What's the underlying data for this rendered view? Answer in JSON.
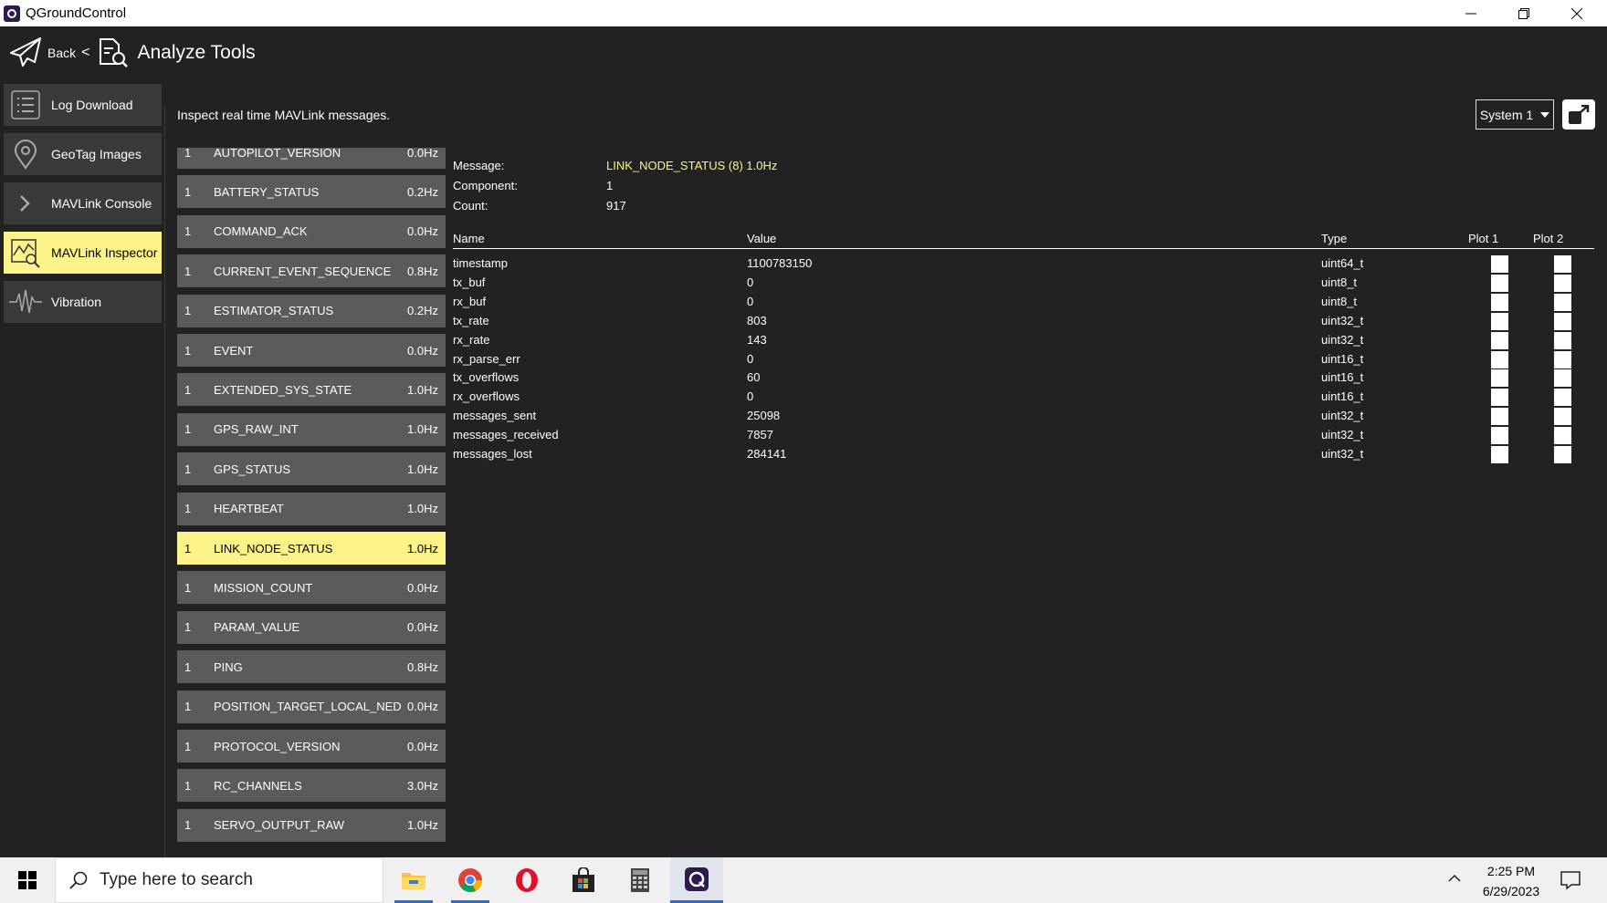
{
  "window": {
    "title": "QGroundControl"
  },
  "header": {
    "back_label": "Back",
    "separator": "<",
    "page_title": "Analyze Tools"
  },
  "sidebar": {
    "items": [
      {
        "label": "Log Download",
        "icon": "list-icon"
      },
      {
        "label": "GeoTag Images",
        "icon": "map-pin-icon"
      },
      {
        "label": "MAVLink Console",
        "icon": "chevron-right-icon"
      },
      {
        "label": "MAVLink Inspector",
        "icon": "chart-magnifier-icon",
        "active": true
      },
      {
        "label": "Vibration",
        "icon": "waveform-icon"
      }
    ]
  },
  "inspector": {
    "description": "Inspect real time MAVLink messages.",
    "system_selector": "System 1",
    "messages": [
      {
        "comp": "1",
        "name": "AUTOPILOT_VERSION",
        "rate": "0.0Hz"
      },
      {
        "comp": "1",
        "name": "BATTERY_STATUS",
        "rate": "0.2Hz"
      },
      {
        "comp": "1",
        "name": "COMMAND_ACK",
        "rate": "0.0Hz"
      },
      {
        "comp": "1",
        "name": "CURRENT_EVENT_SEQUENCE",
        "rate": "0.8Hz"
      },
      {
        "comp": "1",
        "name": "ESTIMATOR_STATUS",
        "rate": "0.2Hz"
      },
      {
        "comp": "1",
        "name": "EVENT",
        "rate": "0.0Hz"
      },
      {
        "comp": "1",
        "name": "EXTENDED_SYS_STATE",
        "rate": "1.0Hz"
      },
      {
        "comp": "1",
        "name": "GPS_RAW_INT",
        "rate": "1.0Hz"
      },
      {
        "comp": "1",
        "name": "GPS_STATUS",
        "rate": "1.0Hz"
      },
      {
        "comp": "1",
        "name": "HEARTBEAT",
        "rate": "1.0Hz"
      },
      {
        "comp": "1",
        "name": "LINK_NODE_STATUS",
        "rate": "1.0Hz",
        "active": true
      },
      {
        "comp": "1",
        "name": "MISSION_COUNT",
        "rate": "0.0Hz"
      },
      {
        "comp": "1",
        "name": "PARAM_VALUE",
        "rate": "0.0Hz"
      },
      {
        "comp": "1",
        "name": "PING",
        "rate": "0.8Hz"
      },
      {
        "comp": "1",
        "name": "POSITION_TARGET_LOCAL_NED",
        "rate": "0.0Hz"
      },
      {
        "comp": "1",
        "name": "PROTOCOL_VERSION",
        "rate": "0.0Hz"
      },
      {
        "comp": "1",
        "name": "RC_CHANNELS",
        "rate": "3.0Hz"
      },
      {
        "comp": "1",
        "name": "SERVO_OUTPUT_RAW",
        "rate": "1.0Hz"
      }
    ],
    "detail": {
      "message_label": "Message:",
      "message_value": "LINK_NODE_STATUS (8) 1.0Hz",
      "component_label": "Component:",
      "component_value": "1",
      "count_label": "Count:",
      "count_value": "917",
      "columns": {
        "name": "Name",
        "value": "Value",
        "type": "Type",
        "plot1": "Plot 1",
        "plot2": "Plot 2"
      },
      "fields": [
        {
          "name": "timestamp",
          "value": "1100783150",
          "type": "uint64_t"
        },
        {
          "name": "tx_buf",
          "value": "0",
          "type": "uint8_t"
        },
        {
          "name": "rx_buf",
          "value": "0",
          "type": "uint8_t"
        },
        {
          "name": "tx_rate",
          "value": "803",
          "type": "uint32_t"
        },
        {
          "name": "rx_rate",
          "value": "143",
          "type": "uint32_t"
        },
        {
          "name": "rx_parse_err",
          "value": "0",
          "type": "uint16_t"
        },
        {
          "name": "tx_overflows",
          "value": "60",
          "type": "uint16_t"
        },
        {
          "name": "rx_overflows",
          "value": "0",
          "type": "uint16_t"
        },
        {
          "name": "messages_sent",
          "value": "25098",
          "type": "uint32_t"
        },
        {
          "name": "messages_received",
          "value": "7857",
          "type": "uint32_t"
        },
        {
          "name": "messages_lost",
          "value": "284141",
          "type": "uint32_t"
        }
      ]
    }
  },
  "taskbar": {
    "search_placeholder": "Type here to search",
    "time": "2:25 PM",
    "date": "6/29/2023",
    "apps": [
      "file-explorer-icon",
      "chrome-icon",
      "opera-icon",
      "store-icon",
      "calculator-icon",
      "qgroundcontrol-icon"
    ]
  },
  "colors": {
    "accent": "#fdf38b",
    "background": "#222222",
    "row": "#5b5b5b"
  }
}
